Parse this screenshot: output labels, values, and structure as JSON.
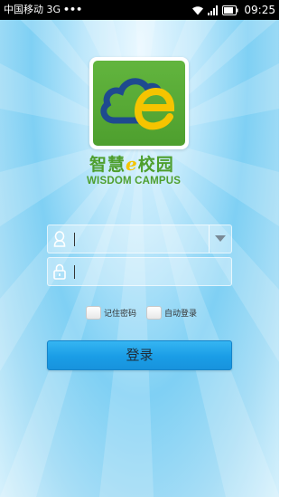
{
  "status_bar": {
    "carrier": "中国移动 3G",
    "more_dots": "•••",
    "time": "09:25"
  },
  "brand": {
    "name_cn_part1": "智慧",
    "name_cn_e": "e",
    "name_cn_part2": "校园",
    "name_en": "WISDOM CAMPUS"
  },
  "login_form": {
    "username": {
      "value": "",
      "placeholder": ""
    },
    "password": {
      "value": "",
      "placeholder": ""
    },
    "remember_password_label": "记住密码",
    "auto_login_label": "自动登录",
    "submit_label": "登录"
  },
  "icons": {
    "wifi": "wifi-icon",
    "signal": "signal-icon",
    "battery": "battery-icon",
    "user": "user-icon",
    "lock": "lock-icon",
    "dropdown": "chevron-down-icon"
  },
  "colors": {
    "brand_green": "#4e9f2e",
    "brand_yellow": "#f5c400",
    "cloud_blue": "#1e4a8f",
    "button_blue": "#1a9de6"
  }
}
